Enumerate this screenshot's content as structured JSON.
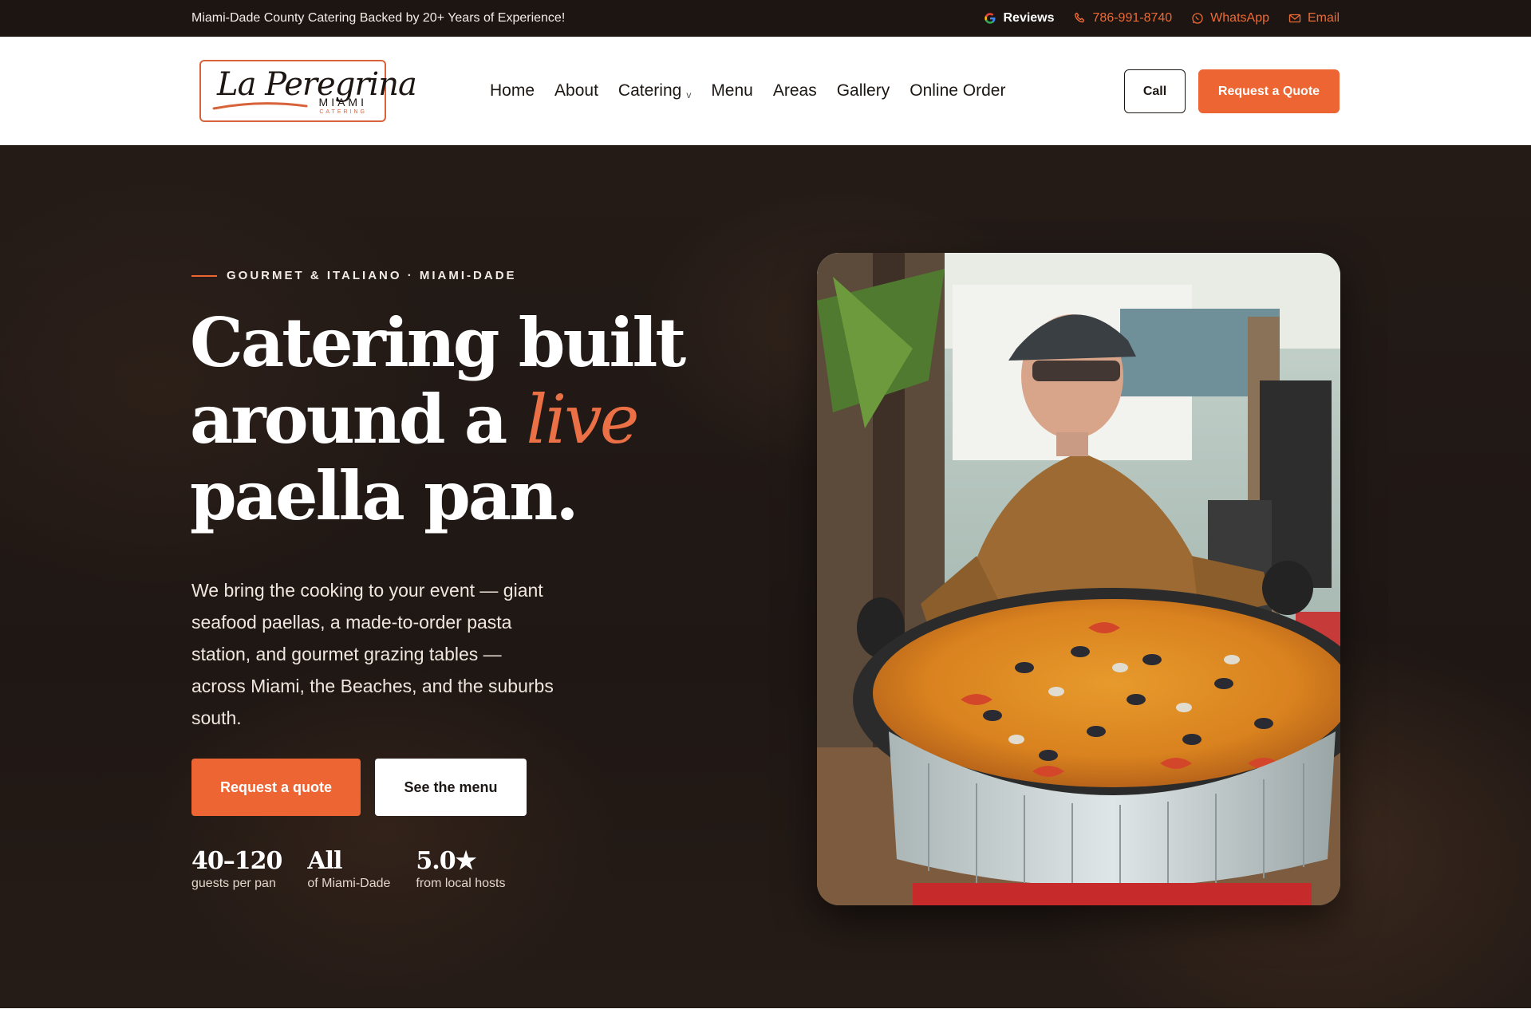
{
  "topbar": {
    "tagline": "Miami-Dade County Catering Backed by 20+ Years of Experience!",
    "reviews": "Reviews",
    "phone": "786-991-8740",
    "whatsapp": "WhatsApp",
    "email": "Email"
  },
  "logo": {
    "script": "La Peregrina",
    "city": "MIAMI",
    "sub": "CATERING"
  },
  "nav": {
    "items": [
      "Home",
      "About",
      "Catering",
      "Menu",
      "Areas",
      "Gallery",
      "Online Order"
    ]
  },
  "header": {
    "call_label": "Call",
    "quote_label": "Request a Quote"
  },
  "hero": {
    "eyebrow": "GOURMET & ITALIANO · MIAMI-DADE",
    "headline_line1": "Catering built",
    "headline_line2a": "around a ",
    "headline_accent": "live",
    "headline_line3": "paella pan.",
    "lede": "We bring the cooking to your event — giant seafood paellas, a made-to-order pasta station, and gourmet grazing tables — across Miami, the Beaches, and the suburbs south.",
    "cta_primary": "Request a quote",
    "cta_secondary": "See the menu",
    "stats": [
      {
        "value": "40–120",
        "label": "guests per pan"
      },
      {
        "value": "All",
        "label": "of Miami-Dade"
      },
      {
        "value": "5.0★",
        "label": "from local hosts"
      }
    ]
  },
  "colors": {
    "accent": "#ec6532",
    "dark": "#1c1512"
  }
}
